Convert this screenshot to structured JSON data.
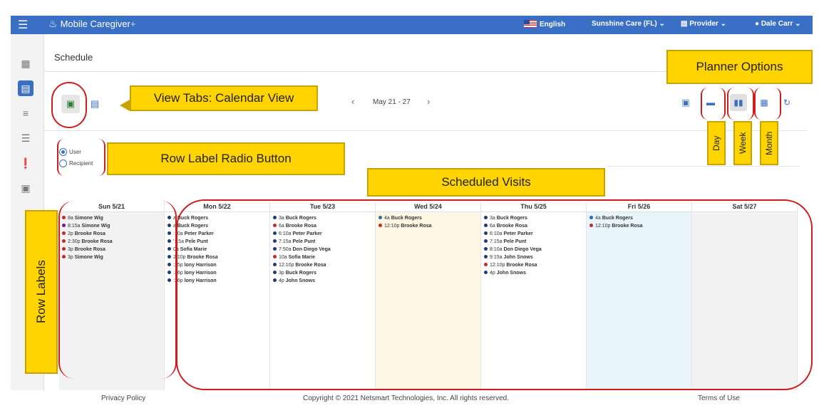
{
  "topbar": {
    "app_name": "Mobile Caregiver",
    "app_suffix": "+",
    "language": "English",
    "agency": "Sunshine Care (FL)",
    "role": "Provider",
    "user": "Dale Carr"
  },
  "page": {
    "title": "Schedule"
  },
  "nav": {
    "date_range": "May 21 - 27",
    "prev_icon": "chevron-left-icon",
    "next_icon": "chevron-right-icon"
  },
  "view_tabs": [
    {
      "icon": "calendar-icon",
      "selected": true
    },
    {
      "icon": "calendar-outline-icon",
      "selected": false
    }
  ],
  "planner_options": [
    {
      "name": "calendar",
      "icon": "calendar-icon",
      "selected": false
    },
    {
      "name": "day",
      "icon": "day-icon",
      "selected": false
    },
    {
      "name": "week",
      "icon": "week-icon",
      "selected": true
    },
    {
      "name": "month",
      "icon": "month-icon",
      "selected": false
    },
    {
      "name": "refresh",
      "icon": "refresh-icon",
      "selected": false
    }
  ],
  "row_label": {
    "options": [
      {
        "label": "User",
        "checked": true
      },
      {
        "label": "Recipient",
        "checked": false
      }
    ]
  },
  "days": [
    {
      "header": "Sun 5/21",
      "bg": "#f2f2f2",
      "visits": [
        {
          "c": "#c62828",
          "t": "8a",
          "n": "Simone Wig"
        },
        {
          "c": "#6a1b9a",
          "t": "8:15a",
          "n": "Simone Wig"
        },
        {
          "c": "#c62828",
          "t": "2p",
          "n": "Brooke Rosa"
        },
        {
          "c": "#c62828",
          "t": "2:30p",
          "n": "Brooke Rosa"
        },
        {
          "c": "#c62828",
          "t": "3p",
          "n": "Brooke Rosa"
        },
        {
          "c": "#c62828",
          "t": "3p",
          "n": "Simone Wig"
        }
      ]
    },
    {
      "header": "Mon 5/22",
      "bg": "#ffffff",
      "visits": [
        {
          "c": "#1f3b73",
          "t": "a",
          "n": "Buck Rogers"
        },
        {
          "c": "#1f3b73",
          "t": "a",
          "n": "Buck Rogers"
        },
        {
          "c": "#1f3b73",
          "t": ":10a",
          "n": "Peter Parker"
        },
        {
          "c": "#1f3b73",
          "t": "':15a",
          "n": "Pele Punt"
        },
        {
          "c": "#1f3b73",
          "t": "0a",
          "n": "Sofia Marie"
        },
        {
          "c": "#1f3b73",
          "t": "2:10p",
          "n": "Brooke Rosa"
        },
        {
          "c": "#1f3b73",
          "t": ":25p",
          "n": "lony Harrison"
        },
        {
          "c": "#1f3b73",
          "t": ":26p",
          "n": "lony Harrison"
        },
        {
          "c": "#1f3b73",
          "t": ":26p",
          "n": "lony Harrison"
        }
      ]
    },
    {
      "header": "Tue 5/23",
      "bg": "#ffffff",
      "visits": [
        {
          "c": "#1f3b73",
          "t": "3a",
          "n": "Buck Rogers"
        },
        {
          "c": "#c62828",
          "t": "6a",
          "n": "Brooke Rosa"
        },
        {
          "c": "#1f3b73",
          "t": "6:10a",
          "n": "Peter Parker"
        },
        {
          "c": "#1f3b73",
          "t": "7:15a",
          "n": "Pele Punt"
        },
        {
          "c": "#1f3b73",
          "t": "7:50a",
          "n": "Don Diego Vega"
        },
        {
          "c": "#c62828",
          "t": "10a",
          "n": "Sofia Marie"
        },
        {
          "c": "#1f3b73",
          "t": "12:10p",
          "n": "Brooke Rosa"
        },
        {
          "c": "#1f3b73",
          "t": "3p",
          "n": "Buck Rogers"
        },
        {
          "c": "#1f3b73",
          "t": "4p",
          "n": "John Snows"
        }
      ]
    },
    {
      "header": "Wed 5/24",
      "bg": "#fdf6e3",
      "visits": [
        {
          "c": "#2e6da4",
          "t": "4a",
          "n": "Buck Rogers"
        },
        {
          "c": "#c62828",
          "t": "12:10p",
          "n": "Brooke Rosa"
        }
      ]
    },
    {
      "header": "Thu 5/25",
      "bg": "#ffffff",
      "visits": [
        {
          "c": "#1f3b73",
          "t": "3a",
          "n": "Buck Rogers"
        },
        {
          "c": "#1f3b73",
          "t": "6a",
          "n": "Brooke Rosa"
        },
        {
          "c": "#1f3b73",
          "t": "6:10a",
          "n": "Peter Parker"
        },
        {
          "c": "#1f3b73",
          "t": "7:15a",
          "n": "Pele Punt"
        },
        {
          "c": "#1f3b73",
          "t": "8:10a",
          "n": "Don Diego Vega"
        },
        {
          "c": "#1f3b73",
          "t": "9:15a",
          "n": "John Snows"
        },
        {
          "c": "#c62828",
          "t": "12:10p",
          "n": "Brooke Rosa"
        },
        {
          "c": "#1f3b73",
          "t": "4p",
          "n": "John Snows"
        }
      ]
    },
    {
      "header": "Fri 5/26",
      "bg": "#e8f4fb",
      "visits": [
        {
          "c": "#2e6da4",
          "t": "4a",
          "n": "Buck Rogers"
        },
        {
          "c": "#c62828",
          "t": "12:10p",
          "n": "Brooke Rosa"
        }
      ]
    },
    {
      "header": "Sat 5/27",
      "bg": "#f2f2f2",
      "visits": []
    }
  ],
  "footer": {
    "privacy": "Privacy Policy",
    "copyright": "Copyright © 2021 Netsmart Technologies, Inc. All rights reserved.",
    "terms": "Terms of Use"
  },
  "callouts": {
    "view_tabs": "View Tabs: Calendar View",
    "row_label_radio": "Row Label Radio Button",
    "scheduled_visits": "Scheduled Visits",
    "planner_options": "Planner Options",
    "day": "Day",
    "week": "Week",
    "month": "Month",
    "row_labels": "Row Labels"
  },
  "colors": {
    "topbar": "#3a6fc6",
    "callout": "#ffd400",
    "annotation": "#d21b1b"
  }
}
